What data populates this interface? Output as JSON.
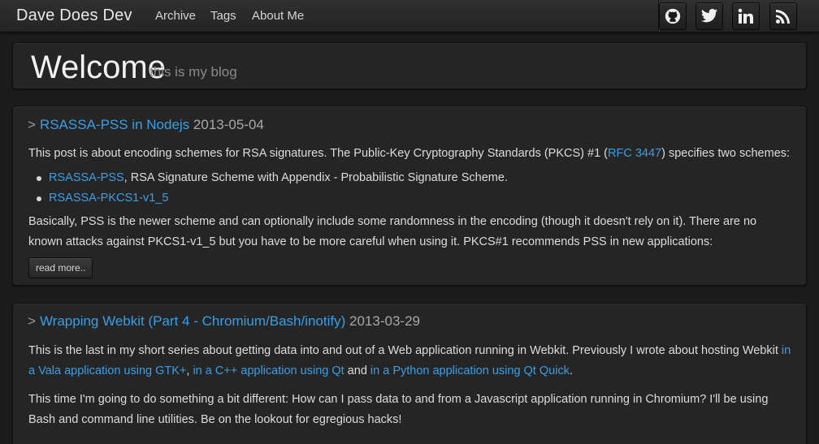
{
  "navbar": {
    "brand": "Dave Does Dev",
    "links": [
      "Archive",
      "Tags",
      "About Me"
    ],
    "social": [
      "github-icon",
      "twitter-icon",
      "linkedin-icon",
      "rss-icon"
    ]
  },
  "hero": {
    "title": "Welcome",
    "subtitle": "this is my blog"
  },
  "posts": [
    {
      "chevron": ">",
      "title": "RSASSA-PSS in Nodejs",
      "date": "2013-05-04",
      "intro_before": "This post is about encoding schemes for RSA signatures. The Public-Key Cryptography Standards (PKCS) #1 (",
      "intro_link": "RFC 3447",
      "intro_after": ") specifies two schemes:",
      "bullets": [
        {
          "link": "RSASSA-PSS",
          "text": ", RSA Signature Scheme with Appendix - Probabilistic Signature Scheme."
        },
        {
          "link": "RSASSA-PKCS1-v1_5",
          "text": ""
        }
      ],
      "para2": "Basically, PSS is the newer scheme and can optionally include some randomness in the encoding (though it doesn't rely on it). There are no known attacks against PKCS1-v1_5 but you have to be more careful when using it. PKCS#1 recommends PSS in new applications:",
      "read_more": "read more.."
    },
    {
      "chevron": ">",
      "title": "Wrapping Webkit (Part 4 - Chromium/Bash/inotify)",
      "date": "2013-03-29",
      "p1_before": "This is the last in my short series about getting data into and out of a Web application running in Webkit. Previously I wrote about hosting Webkit ",
      "p1_link1": "in a Vala application using GTK+",
      "p1_sep": ", ",
      "p1_link2": "in a C++ application using Qt",
      "p1_and": " and ",
      "p1_link3": "in a Python application using Qt Quick",
      "p1_end": ".",
      "p2": "This time I'm going to do something a bit different: How can I pass data to and from a Javascript application running in Chromium? I'll be using Bash and command line utilities. Be on the lookout for egregious hacks!"
    }
  ],
  "colors": {
    "background": "#1c1c1c",
    "panel": "#252525",
    "link": "#3a9ee6",
    "text": "#dcdcdc"
  }
}
